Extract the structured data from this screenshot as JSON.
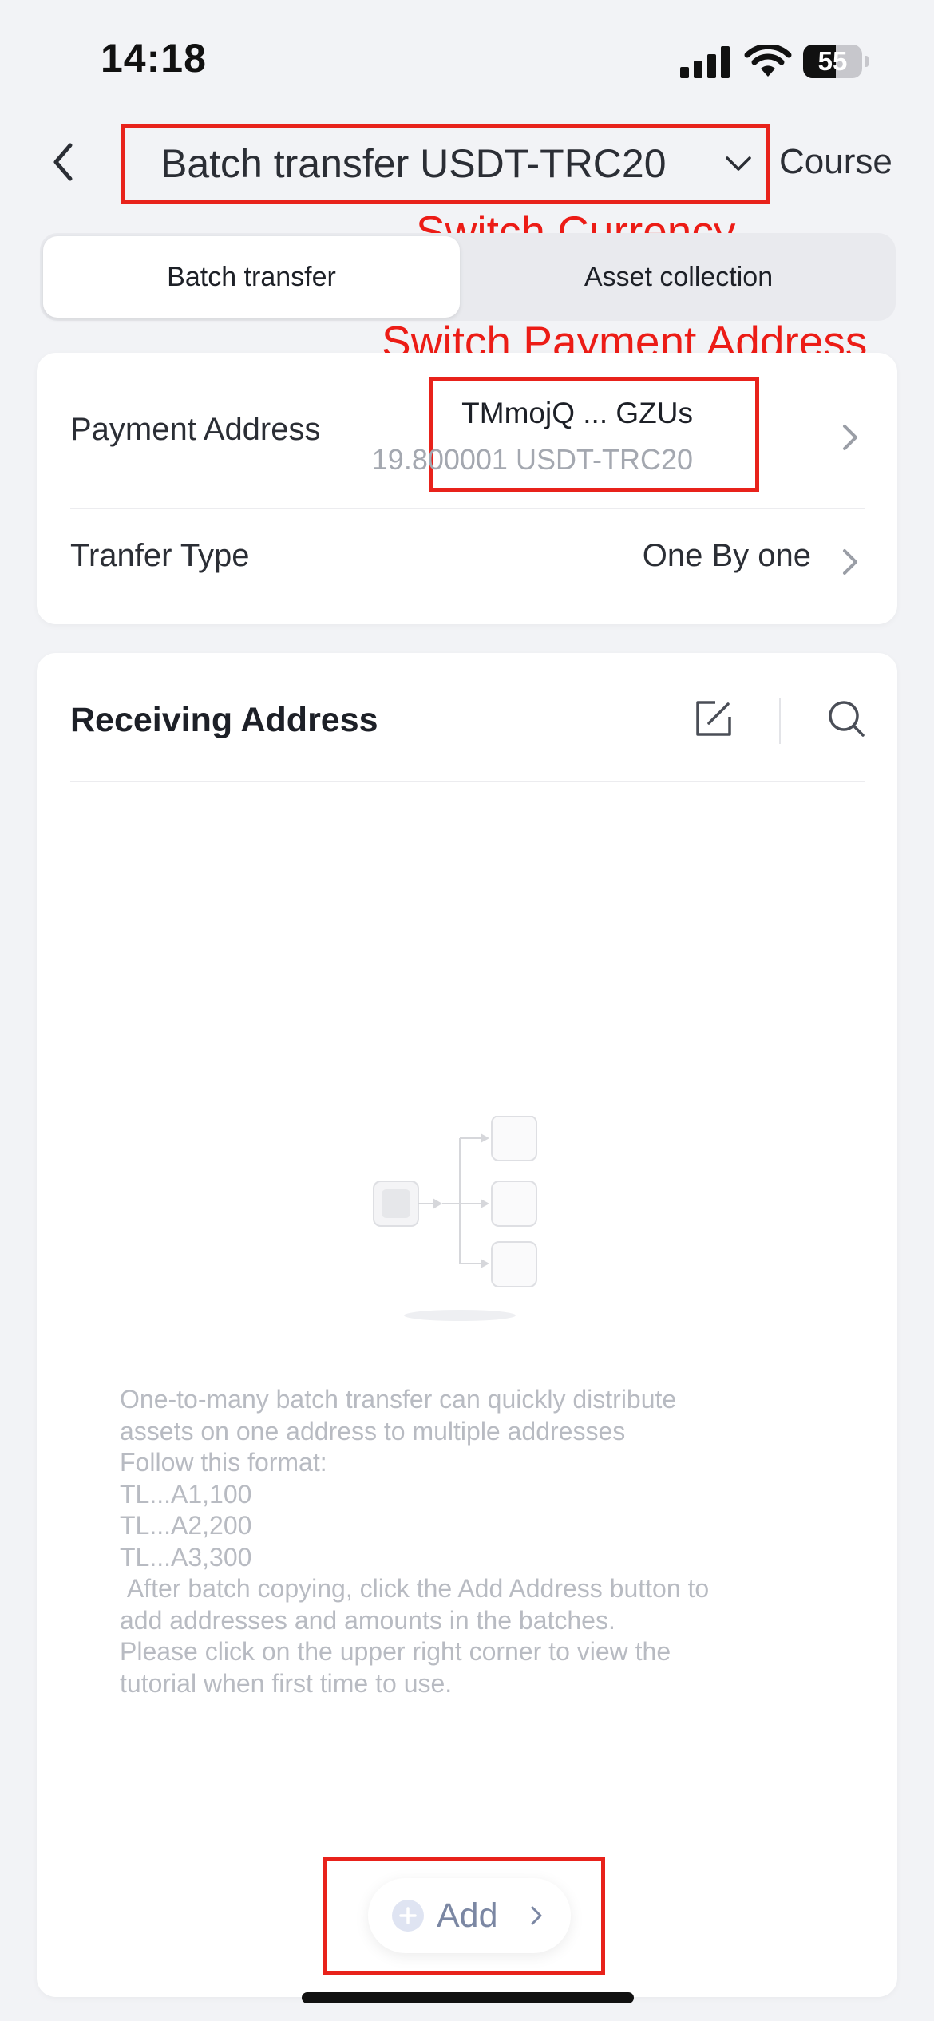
{
  "status_bar": {
    "time": "14:18",
    "battery_level": "55",
    "icons": [
      "signal-icon",
      "wifi-icon",
      "battery-icon"
    ]
  },
  "header": {
    "title": "Batch transfer USDT-TRC20",
    "right_link": "Course",
    "icons": [
      "back-arrow-icon",
      "chevron-down-icon"
    ]
  },
  "annotations": {
    "switch_currency": "Switch Currency",
    "switch_payment_address": "Switch Payment Address",
    "color": "#e8221b"
  },
  "tabs": [
    {
      "label": "Batch transfer",
      "active": true
    },
    {
      "label": "Asset collection",
      "active": false
    }
  ],
  "payment": {
    "label": "Payment Address",
    "address": "TMmojQ ... GZUs",
    "balance": "19.800001 USDT-TRC20"
  },
  "transfer_type": {
    "label": "Tranfer Type",
    "value": "One By one"
  },
  "receiving": {
    "title": "Receiving Address",
    "icons": [
      "edit-icon",
      "search-icon",
      "batch-transfer-illustration-icon"
    ],
    "hint": "One-to-many batch transfer can quickly distribute\nassets on one address to multiple addresses\nFollow this format:\nTL...A1,100\nTL...A2,200\nTL...A3,300\n After batch copying, click the Add Address button to\nadd addresses and amounts in the batches.\nPlease click on the upper right corner to view the\ntutorial when first time to use."
  },
  "add_button": {
    "label": "Add"
  },
  "colors": {
    "background": "#f2f3f6",
    "card": "#ffffff",
    "text": "#2b2e35",
    "muted": "#a4a8b0",
    "add_text": "#7b87a3"
  }
}
